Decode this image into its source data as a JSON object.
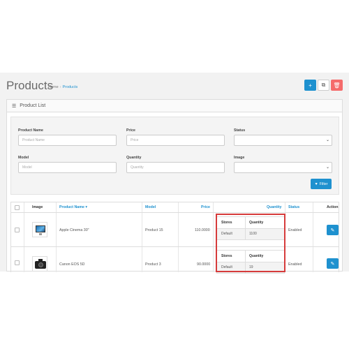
{
  "header": {
    "title": "Products",
    "breadcrumb": [
      "Home",
      "Products"
    ],
    "actions": {
      "add_icon": "plus-icon",
      "copy_icon": "copy-icon",
      "delete_icon": "trash-icon"
    }
  },
  "panel": {
    "heading": "Product List",
    "heading_icon": "list-icon"
  },
  "filter": {
    "product_name_label": "Product Name",
    "product_name_placeholder": "Product Name",
    "price_label": "Price",
    "price_placeholder": "Price",
    "status_label": "Status",
    "model_label": "Model",
    "model_placeholder": "Model",
    "quantity_label": "Quantity",
    "quantity_placeholder": "Quantity",
    "image_label": "Image",
    "filter_button": "Filter"
  },
  "table": {
    "columns": [
      "Image",
      "Product Name",
      "Model",
      "Price",
      "Quantity",
      "Status",
      "Action"
    ],
    "sort_indicator": "▾",
    "stock_columns": [
      "Stores",
      "Quantity"
    ],
    "rows": [
      {
        "name": "Apple Cinema 30\"",
        "model": "Product 15",
        "price": "110.0000",
        "store": "Default",
        "quantity": "1100",
        "status": "Enabled"
      },
      {
        "name": "Canon EOS 5D",
        "model": "Product 3",
        "price": "90.0000",
        "store": "Default",
        "quantity": "19",
        "status": "Enabled"
      }
    ]
  },
  "colors": {
    "primary": "#1e91cf",
    "danger": "#f56b6b",
    "highlight": "#d63b3b"
  }
}
